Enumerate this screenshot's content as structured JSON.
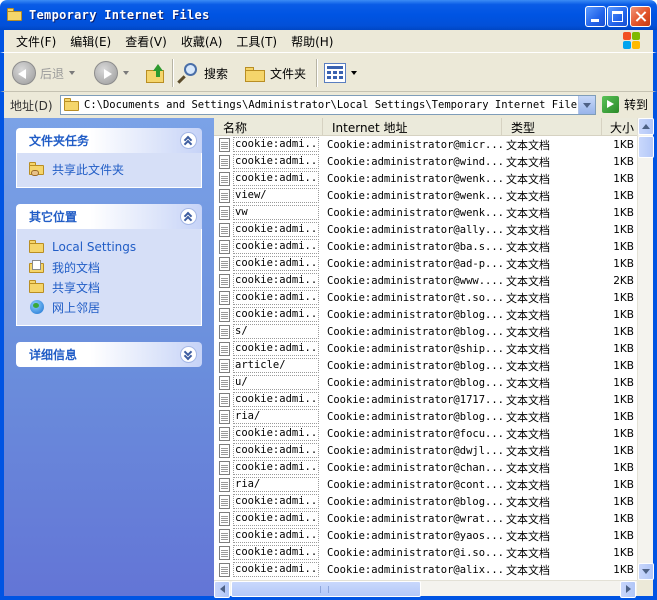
{
  "window": {
    "title": "Temporary Internet Files"
  },
  "menu": [
    "文件(F)",
    "编辑(E)",
    "查看(V)",
    "收藏(A)",
    "工具(T)",
    "帮助(H)"
  ],
  "toolbar": {
    "back": "后退",
    "search": "搜索",
    "folders": "文件夹"
  },
  "address": {
    "label": "地址(D)",
    "path": "C:\\Documents and Settings\\Administrator\\Local Settings\\Temporary Internet Files",
    "go": "转到"
  },
  "taskpane": {
    "file_tasks": {
      "title": "文件夹任务",
      "items": [
        {
          "label": "共享此文件夹",
          "icon": "share-folder-icon"
        }
      ]
    },
    "other_places": {
      "title": "其它位置",
      "items": [
        {
          "label": "Local Settings",
          "icon": "folder-icon"
        },
        {
          "label": "我的文档",
          "icon": "my-documents-icon"
        },
        {
          "label": "共享文档",
          "icon": "shared-documents-icon"
        },
        {
          "label": "网上邻居",
          "icon": "network-icon"
        }
      ]
    },
    "details": {
      "title": "详细信息"
    }
  },
  "columns": {
    "name": "名称",
    "address": "Internet 地址",
    "type": "类型",
    "size": "大小"
  },
  "files": [
    {
      "name": "cookie:admi...",
      "address": "Cookie:administrator@micr...",
      "type": "文本文档",
      "size": "1KB"
    },
    {
      "name": "cookie:admi...",
      "address": "Cookie:administrator@wind...",
      "type": "文本文档",
      "size": "1KB"
    },
    {
      "name": "cookie:admi...",
      "address": "Cookie:administrator@wenk...",
      "type": "文本文档",
      "size": "1KB"
    },
    {
      "name": "view/",
      "address": "Cookie:administrator@wenk...",
      "type": "文本文档",
      "size": "1KB"
    },
    {
      "name": "vw",
      "address": "Cookie:administrator@wenk...",
      "type": "文本文档",
      "size": "1KB"
    },
    {
      "name": "cookie:admi...",
      "address": "Cookie:administrator@ally...",
      "type": "文本文档",
      "size": "1KB"
    },
    {
      "name": "cookie:admi...",
      "address": "Cookie:administrator@ba.s...",
      "type": "文本文档",
      "size": "1KB"
    },
    {
      "name": "cookie:admi...",
      "address": "Cookie:administrator@ad-p...",
      "type": "文本文档",
      "size": "1KB"
    },
    {
      "name": "cookie:admi...",
      "address": "Cookie:administrator@www....",
      "type": "文本文档",
      "size": "2KB"
    },
    {
      "name": "cookie:admi...",
      "address": "Cookie:administrator@t.so...",
      "type": "文本文档",
      "size": "1KB"
    },
    {
      "name": "cookie:admi...",
      "address": "Cookie:administrator@blog...",
      "type": "文本文档",
      "size": "1KB"
    },
    {
      "name": "s/",
      "address": "Cookie:administrator@blog...",
      "type": "文本文档",
      "size": "1KB"
    },
    {
      "name": "cookie:admi...",
      "address": "Cookie:administrator@ship...",
      "type": "文本文档",
      "size": "1KB"
    },
    {
      "name": "article/",
      "address": "Cookie:administrator@blog...",
      "type": "文本文档",
      "size": "1KB"
    },
    {
      "name": "u/",
      "address": "Cookie:administrator@blog...",
      "type": "文本文档",
      "size": "1KB"
    },
    {
      "name": "cookie:admi...",
      "address": "Cookie:administrator@1717...",
      "type": "文本文档",
      "size": "1KB"
    },
    {
      "name": "ria/",
      "address": "Cookie:administrator@blog...",
      "type": "文本文档",
      "size": "1KB"
    },
    {
      "name": "cookie:admi...",
      "address": "Cookie:administrator@focu...",
      "type": "文本文档",
      "size": "1KB"
    },
    {
      "name": "cookie:admi...",
      "address": "Cookie:administrator@dwjl...",
      "type": "文本文档",
      "size": "1KB"
    },
    {
      "name": "cookie:admi...",
      "address": "Cookie:administrator@chan...",
      "type": "文本文档",
      "size": "1KB"
    },
    {
      "name": "ria/",
      "address": "Cookie:administrator@cont...",
      "type": "文本文档",
      "size": "1KB"
    },
    {
      "name": "cookie:admi...",
      "address": "Cookie:administrator@blog...",
      "type": "文本文档",
      "size": "1KB"
    },
    {
      "name": "cookie:admi...",
      "address": "Cookie:administrator@wrat...",
      "type": "文本文档",
      "size": "1KB"
    },
    {
      "name": "cookie:admi...",
      "address": "Cookie:administrator@yaos...",
      "type": "文本文档",
      "size": "1KB"
    },
    {
      "name": "cookie:admi...",
      "address": "Cookie:administrator@i.so...",
      "type": "文本文档",
      "size": "1KB"
    },
    {
      "name": "cookie:admi...",
      "address": "Cookie:administrator@alix...",
      "type": "文本文档",
      "size": "1KB"
    }
  ]
}
